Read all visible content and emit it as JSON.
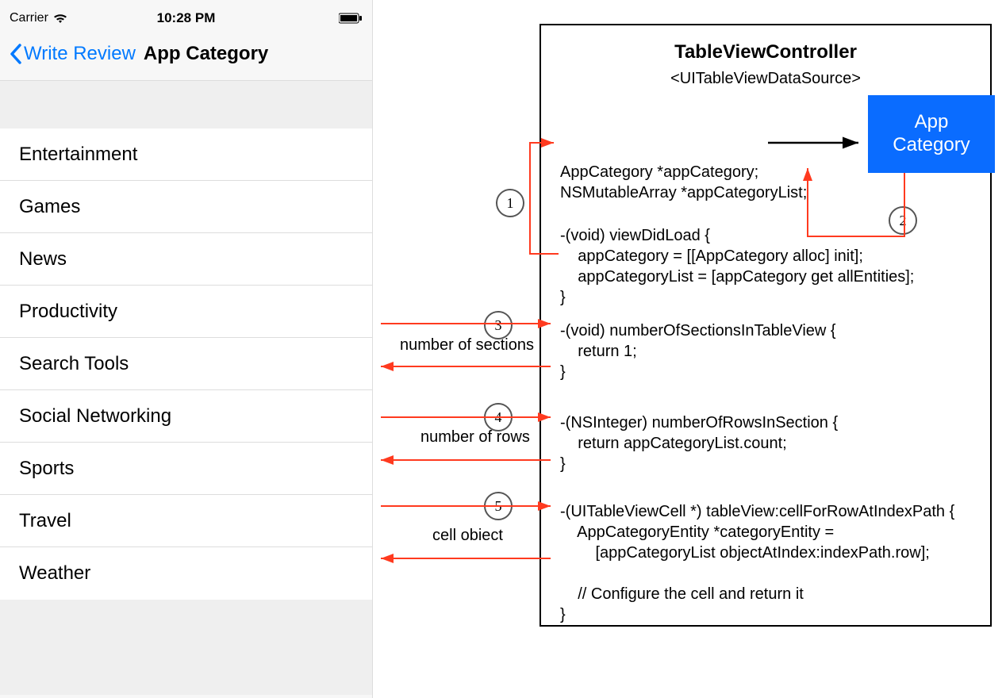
{
  "status_bar": {
    "carrier": "Carrier",
    "time": "10:28 PM"
  },
  "nav": {
    "back_label": "Write Review",
    "title": "App Category"
  },
  "categories": [
    "Entertainment",
    "Games",
    "News",
    "Productivity",
    "Search Tools",
    "Social Networking",
    "Sports",
    "Travel",
    "Weather"
  ],
  "controller": {
    "title": "TableViewController",
    "subtitle": "<UITableViewDataSource>",
    "blue_box_line1": "App",
    "blue_box_line2": "Category",
    "decl_line1": "AppCategory *appCategory;",
    "decl_line2": "NSMutableArray *appCategoryList;",
    "viewDidLoad_head": "-(void) viewDidLoad {",
    "viewDidLoad_body1": "    appCategory = [[AppCategory alloc] init];",
    "viewDidLoad_body2": "    appCategoryList = [appCategory get allEntities];",
    "close_brace": "}",
    "numSections_head": "-(void) numberOfSectionsInTableView {",
    "numSections_body": "    return 1;",
    "numRows_head": "-(NSInteger) numberOfRowsInSection {",
    "numRows_body": "    return appCategoryList.count;",
    "cellFor_head": "-(UITableViewCell *) tableView:cellForRowAtIndexPath {",
    "cellFor_body1": "    AppCategoryEntity *categoryEntity =",
    "cellFor_body2": "        [appCategoryList objectAtIndex:indexPath.row];",
    "cellFor_comment": "    // Configure the cell and return it"
  },
  "labels": {
    "num_sections": "number of sections",
    "num_rows": "number of rows",
    "cell_object": "cell obiect"
  },
  "circles": {
    "c1": "1",
    "c2": "2",
    "c3": "3",
    "c4": "4",
    "c5": "5"
  }
}
